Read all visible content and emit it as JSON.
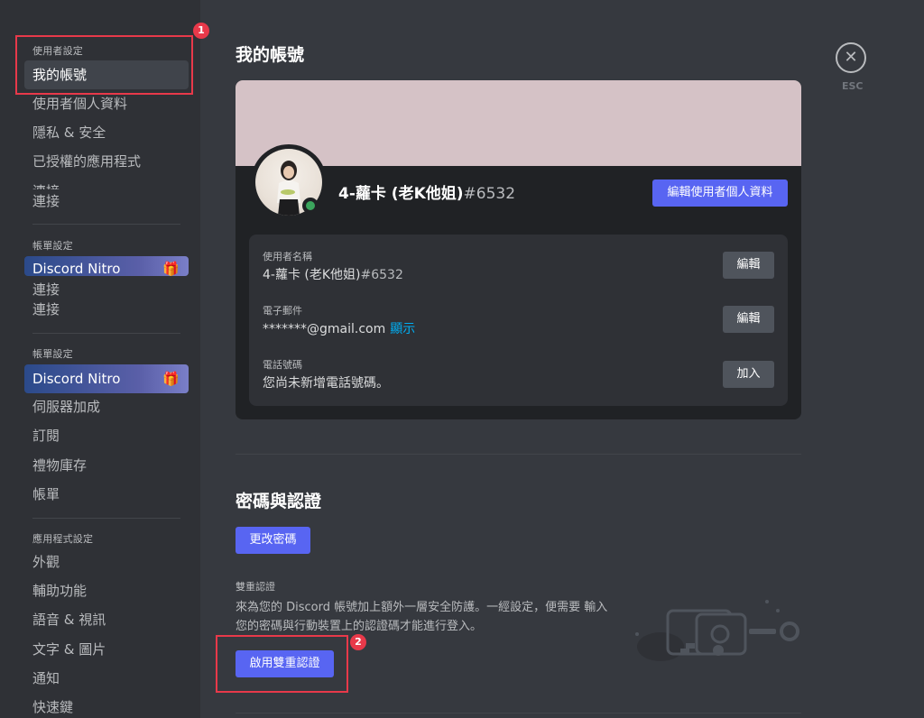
{
  "sidebar": {
    "sections": [
      {
        "header": "使用者設定",
        "items": [
          "我的帳號",
          "使用者個人資料",
          "隱私 & 安全",
          "已授權的應用程式",
          "連接"
        ]
      },
      {
        "header": "帳單設定",
        "items": [
          "Discord Nitro",
          "連接",
          "連接"
        ]
      },
      {
        "header": "帳單設定",
        "items": [
          "Discord Nitro",
          "伺服器加成",
          "訂閱",
          "禮物庫存",
          "帳單"
        ]
      },
      {
        "header": "應用程式設定",
        "items": [
          "外觀",
          "輔助功能",
          "語音 & 視訊",
          "文字 & 圖片",
          "通知",
          "快速鍵"
        ]
      }
    ],
    "clipped_item": "連接",
    "gift_glyph": "🎁"
  },
  "main": {
    "title": "我的帳號",
    "card": {
      "username": "4-蘿卡 (老K他姐)",
      "tag": "#6532",
      "edit_profile_button": "編輯使用者個人資料",
      "banner_color": "#d5c2c6",
      "status": "online",
      "fields": [
        {
          "label": "使用者名稱",
          "value": "4-蘿卡 (老K他姐)",
          "value_suffix": "#6532",
          "button": "編輯"
        },
        {
          "label": "電子郵件",
          "value": "*******@gmail.com",
          "link": "顯示",
          "button": "編輯"
        },
        {
          "label": "電話號碼",
          "value": "您尚未新增電話號碼。",
          "button": "加入"
        }
      ]
    },
    "password_section": {
      "title": "密碼與認證",
      "change_password_button": "更改密碼",
      "twofa_label": "雙重認證",
      "twofa_description": "來為您的 Discord 帳號加上額外一層安全防護。一經設定，便需要 輸入您的密碼與行動裝置上的認證碼才能進行登入。",
      "enable_2fa_button": "啟用雙重認證"
    }
  },
  "close": {
    "icon": "close-icon",
    "glyph": "✕",
    "label": "ESC"
  },
  "annotations": [
    {
      "number": "1"
    },
    {
      "number": "2"
    }
  ],
  "colors": {
    "accent": "#5865f2",
    "annotation": "#e8394a",
    "online": "#3ba55d",
    "link": "#00aff4"
  }
}
